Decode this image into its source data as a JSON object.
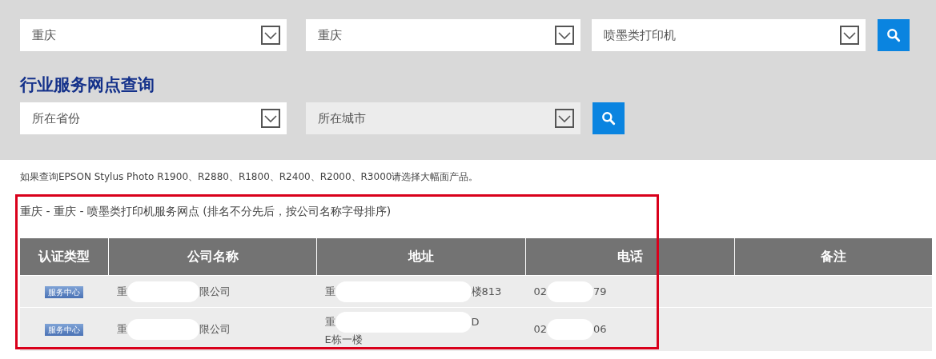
{
  "search_rows": [
    {
      "title": null,
      "selects": [
        {
          "value": "重庆",
          "disabled": false
        },
        {
          "value": "重庆",
          "disabled": false
        },
        {
          "value": "喷墨类打印机",
          "disabled": false
        }
      ]
    },
    {
      "title": "行业服务网点查询",
      "selects": [
        {
          "placeholder": "所在省份",
          "disabled": false
        },
        {
          "placeholder": "所在城市",
          "disabled": true
        }
      ]
    }
  ],
  "note": "如果查询EPSON Stylus Photo R1900、R2880、R1800、R2400、R2000、R3000请选择大幅面产品。",
  "result_title": "重庆 - 重庆 - 喷墨类打印机服务网点 (排名不分先后，按公司名称字母排序)",
  "table": {
    "columns": [
      "认证类型",
      "公司名称",
      "地址",
      "电话",
      "备注"
    ],
    "rows": [
      {
        "badge": "服务中心",
        "company": [
          [
            {
              "kind": "text",
              "text": "重"
            },
            {
              "kind": "redaction"
            },
            {
              "kind": "text",
              "text": "限公司"
            }
          ]
        ],
        "address": [
          [
            {
              "kind": "text",
              "text": "重"
            },
            {
              "kind": "redaction"
            },
            {
              "kind": "text",
              "text": "楼813"
            }
          ]
        ],
        "phone": [
          [
            {
              "kind": "text",
              "text": "02"
            },
            {
              "kind": "redaction"
            },
            {
              "kind": "text",
              "text": "79"
            }
          ]
        ]
      },
      {
        "badge": "服务中心",
        "company": [
          [
            {
              "kind": "text",
              "text": "重"
            },
            {
              "kind": "redaction"
            },
            {
              "kind": "text",
              "text": "限公司"
            }
          ]
        ],
        "address": [
          [
            {
              "kind": "text",
              "text": "重"
            },
            {
              "kind": "redaction"
            },
            {
              "kind": "text",
              "text": "D"
            }
          ],
          [
            {
              "kind": "text",
              "text": "E栋一楼"
            }
          ]
        ],
        "phone": [
          [
            {
              "kind": "text",
              "text": "02"
            },
            {
              "kind": "redaction"
            },
            {
              "kind": "text",
              "text": "06"
            }
          ]
        ]
      }
    ]
  },
  "annotation": {
    "kind": "highlight-frame",
    "color": "#d9001b"
  }
}
